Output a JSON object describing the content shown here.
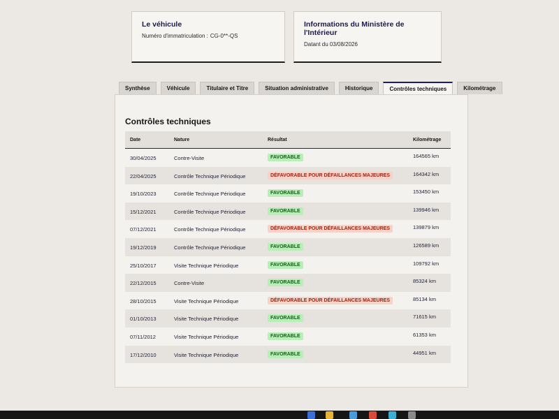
{
  "vehicle_card": {
    "title": "Le véhicule",
    "plate_label": "Numéro d'immatriculation :",
    "plate_value": "CG-0**-QS"
  },
  "ministry_card": {
    "title": "Informations du Ministère de l'Intérieur",
    "date_text": "Datant du 03/08/2026"
  },
  "tabs": [
    {
      "label": "Synthèse",
      "active": false
    },
    {
      "label": "Véhicule",
      "active": false
    },
    {
      "label": "Titulaire et Titre",
      "active": false
    },
    {
      "label": "Situation administrative",
      "active": false
    },
    {
      "label": "Historique",
      "active": false
    },
    {
      "label": "Contrôles techniques",
      "active": true
    },
    {
      "label": "Kilométrage",
      "active": false
    }
  ],
  "section": {
    "title": "Contrôles techniques",
    "columns": {
      "date": "Date",
      "nature": "Nature",
      "result": "Résultat",
      "km": "Kilométrage"
    },
    "rows": [
      {
        "date": "30/04/2025",
        "nature": "Contre-Visite",
        "result": "FAVORABLE",
        "status": "ok",
        "km": "164565 km"
      },
      {
        "date": "22/04/2025",
        "nature": "Contrôle Technique Périodique",
        "result": "DÉFAVORABLE POUR DÉFAILLANCES MAJEURES",
        "status": "ko",
        "km": "164342 km"
      },
      {
        "date": "19/10/2023",
        "nature": "Contrôle Technique Périodique",
        "result": "FAVORABLE",
        "status": "ok",
        "km": "153450 km"
      },
      {
        "date": "15/12/2021",
        "nature": "Contrôle Technique Périodique",
        "result": "FAVORABLE",
        "status": "ok",
        "km": "139946 km"
      },
      {
        "date": "07/12/2021",
        "nature": "Contrôle Technique Périodique",
        "result": "DÉFAVORABLE POUR DÉFAILLANCES MAJEURES",
        "status": "ko",
        "km": "139879 km"
      },
      {
        "date": "19/12/2019",
        "nature": "Contrôle Technique Périodique",
        "result": "FAVORABLE",
        "status": "ok",
        "km": "126589 km"
      },
      {
        "date": "25/10/2017",
        "nature": "Visite Technique Périodique",
        "result": "FAVORABLE",
        "status": "ok",
        "km": "109792 km"
      },
      {
        "date": "22/12/2015",
        "nature": "Contre-Visite",
        "result": "FAVORABLE",
        "status": "ok",
        "km": "85324 km"
      },
      {
        "date": "28/10/2015",
        "nature": "Visite Technique Périodique",
        "result": "DÉFAVORABLE POUR DÉFAILLANCES MAJEURES",
        "status": "ko",
        "km": "85134 km"
      },
      {
        "date": "01/10/2013",
        "nature": "Visite Technique Périodique",
        "result": "FAVORABLE",
        "status": "ok",
        "km": "71615 km"
      },
      {
        "date": "07/11/2012",
        "nature": "Visite Technique Périodique",
        "result": "FAVORABLE",
        "status": "ok",
        "km": "61353 km"
      },
      {
        "date": "17/12/2010",
        "nature": "Visite Technique Périodique",
        "result": "FAVORABLE",
        "status": "ok",
        "km": "44951 km"
      }
    ]
  },
  "colors": {
    "accent": "#1a1a7a",
    "favorable_bg": "#b8eeb8",
    "defavorable_bg": "#f6d2c9"
  }
}
